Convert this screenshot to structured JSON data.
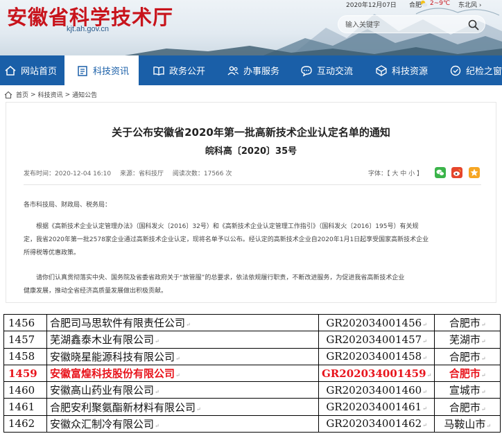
{
  "header": {
    "site_title": "安徽省科学技术厅",
    "domain": "kjt.ah.gov.cn",
    "date": "2020年12月07日",
    "location": "合肥",
    "temperature": "2~9℃",
    "wind": "东北风 ›",
    "search_placeholder": "输入关键字"
  },
  "nav": {
    "items": [
      {
        "label": "网站首页",
        "icon": "home-icon"
      },
      {
        "label": "科技资讯",
        "icon": "news-icon",
        "active": true
      },
      {
        "label": "政务公开",
        "icon": "book-icon"
      },
      {
        "label": "办事服务",
        "icon": "people-icon"
      },
      {
        "label": "互动交流",
        "icon": "chat-icon"
      },
      {
        "label": "科技资源",
        "icon": "cube-icon"
      },
      {
        "label": "纪检之窗",
        "icon": "shield-icon"
      }
    ]
  },
  "breadcrumb": [
    "首页",
    "科技资讯",
    "通知公告"
  ],
  "article": {
    "title": "关于公布安徽省2020年第一批高新技术企业认定名单的通知",
    "doc_number": "皖科高〔2020〕35号",
    "publish_time": "发布时间：2020-12-04 16:10",
    "source": "来源：省科技厅",
    "views": "阅读次数：17566 次",
    "font_size_label": "字体：【 大 中 小 】",
    "salutation": "各市科技局、财政局、税务局：",
    "paragraph1_line1": "根据《高新技术企业认定管理办法》（国科发火〔2016〕32号）和《高新技术企业认定管理工作指引》（国科发火〔2016〕195号）有关规",
    "paragraph1_line2": "定，我省2020年第一批2578家企业通过高新技术企业认定，现将名单予以公布。经认定的高新技术企业自2020年1月1日起享受国家高新技术企业",
    "paragraph1_line3": "所得税等优惠政策。",
    "paragraph2_line1": "请你们认真贯彻落实中央、国务院及省委省政府关于“放管服”的总要求，依法依规履行职责，不断改进服务，为促进我省高新技术企业",
    "paragraph2_line2": "健康发展，推动全省经济高质量发展做出积极贡献。"
  },
  "share_colors": {
    "wechat": "#3bb44a",
    "weibo": "#e6452c",
    "qzone": "#f6a623"
  },
  "highlight_color": "#e8141c",
  "table": {
    "rows": [
      {
        "num": "1456",
        "name": "合肥司马思软件有限责任公司",
        "code": "GR202034001456",
        "city": "合肥市"
      },
      {
        "num": "1457",
        "name": "芜湖鑫泰木业有限公司",
        "code": "GR202034001457",
        "city": "芜湖市"
      },
      {
        "num": "1458",
        "name": "安徽晓星能源科技有限公司",
        "code": "GR202034001458",
        "city": "合肥市"
      },
      {
        "num": "1459",
        "name": "安徽富煌科技股份有限公司",
        "code": "GR202034001459",
        "city": "合肥市",
        "highlight": true
      },
      {
        "num": "1460",
        "name": "安徽高山药业有限公司",
        "code": "GR202034001460",
        "city": "宣城市"
      },
      {
        "num": "1461",
        "name": "合肥安利聚氨酯新材料有限公司",
        "code": "GR202034001461",
        "city": "合肥市"
      },
      {
        "num": "1462",
        "name": "安徽众汇制冷有限公司",
        "code": "GR202034001462",
        "city": "马鞍山市"
      }
    ]
  }
}
